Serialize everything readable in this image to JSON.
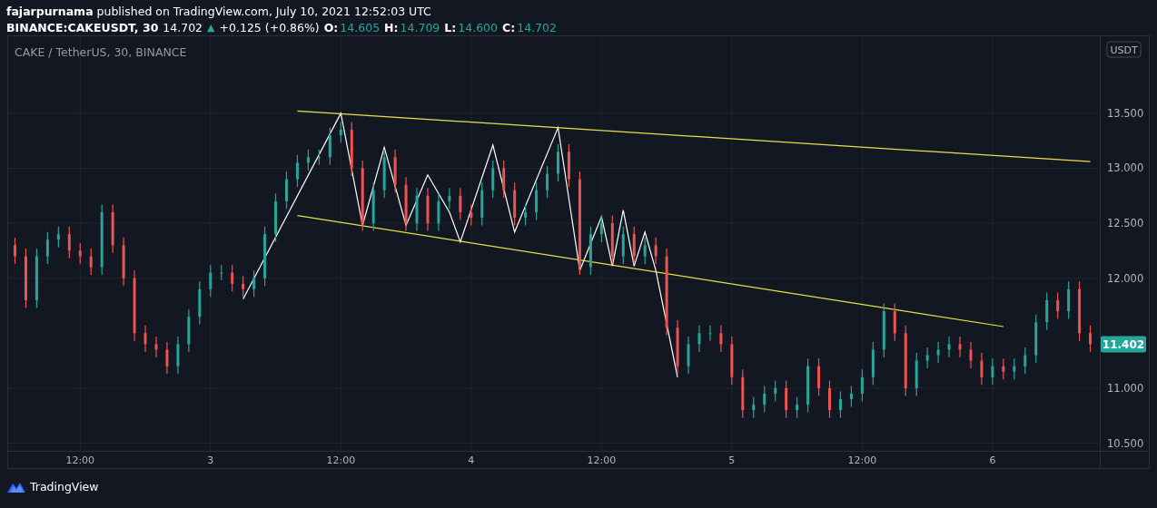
{
  "header": {
    "published": "**fajarpurnama** published on TradingView.com, July 10, 2021 12:52:03 UTC"
  },
  "symbol_line": {
    "symbol": "BINANCE:CAKEUSDT, 30",
    "last": "14.702",
    "arrow": "▲",
    "change": "+0.125 (+0.86%)",
    "ohlc": [
      {
        "label": "O:",
        "value": "14.605"
      },
      {
        "label": "H:",
        "value": "14.709"
      },
      {
        "label": "L:",
        "value": "14.600"
      },
      {
        "label": "C:",
        "value": "14.702"
      }
    ]
  },
  "chart": {
    "legend": "CAKE / TetherUS, 30, BINANCE",
    "currency": "USDT",
    "last_price": "11.402",
    "chart_data": {
      "type": "candlestick",
      "categories": [
        null,
        null,
        null,
        null,
        null,
        null,
        "12:00",
        null,
        null,
        null,
        null,
        null,
        null,
        null,
        null,
        null,
        null,
        null,
        "3",
        null,
        null,
        null,
        null,
        null,
        null,
        null,
        null,
        null,
        null,
        null,
        "12:00",
        null,
        null,
        null,
        null,
        null,
        null,
        null,
        null,
        null,
        null,
        null,
        "4",
        null,
        null,
        null,
        null,
        null,
        null,
        null,
        null,
        null,
        null,
        null,
        "12:00",
        null,
        null,
        null,
        null,
        null,
        null,
        null,
        null,
        null,
        null,
        null,
        "5",
        null,
        null,
        null,
        null,
        null,
        null,
        null,
        null,
        null,
        null,
        null,
        "12:00",
        null,
        null,
        null,
        null,
        null,
        null,
        null,
        null,
        null,
        null,
        null,
        "6",
        null,
        null,
        null,
        null,
        null,
        null,
        null,
        null,
        null
      ],
      "ohlc": [
        [
          12.3,
          12.37,
          12.13,
          12.2
        ],
        [
          12.2,
          12.27,
          11.73,
          11.8
        ],
        [
          11.8,
          12.27,
          11.73,
          12.2
        ],
        [
          12.2,
          12.42,
          12.13,
          12.35
        ],
        [
          12.35,
          12.47,
          12.28,
          12.4
        ],
        [
          12.4,
          12.47,
          12.18,
          12.25
        ],
        [
          12.25,
          12.32,
          12.13,
          12.2
        ],
        [
          12.2,
          12.27,
          12.03,
          12.1
        ],
        [
          12.1,
          12.67,
          12.03,
          12.6
        ],
        [
          12.6,
          12.67,
          12.23,
          12.3
        ],
        [
          12.3,
          12.37,
          11.93,
          12.0
        ],
        [
          12.0,
          12.07,
          11.43,
          11.5
        ],
        [
          11.5,
          11.57,
          11.33,
          11.4
        ],
        [
          11.4,
          11.47,
          11.28,
          11.35
        ],
        [
          11.35,
          11.42,
          11.13,
          11.2
        ],
        [
          11.2,
          11.47,
          11.13,
          11.4
        ],
        [
          11.4,
          11.72,
          11.33,
          11.65
        ],
        [
          11.65,
          11.97,
          11.58,
          11.9
        ],
        [
          11.9,
          12.12,
          11.83,
          12.05
        ],
        [
          12.05,
          12.12,
          11.98,
          12.05
        ],
        [
          12.05,
          12.12,
          11.88,
          11.95
        ],
        [
          11.95,
          12.02,
          11.83,
          11.9
        ],
        [
          11.9,
          12.07,
          11.83,
          12.0
        ],
        [
          12.0,
          12.47,
          11.93,
          12.4
        ],
        [
          12.4,
          12.77,
          12.33,
          12.7
        ],
        [
          12.7,
          12.97,
          12.63,
          12.9
        ],
        [
          12.9,
          13.12,
          12.83,
          13.05
        ],
        [
          13.05,
          13.17,
          12.98,
          13.1
        ],
        [
          13.1,
          13.17,
          13.03,
          13.1
        ],
        [
          13.1,
          13.37,
          13.03,
          13.3
        ],
        [
          13.3,
          13.42,
          13.23,
          13.35
        ],
        [
          13.35,
          13.42,
          12.93,
          13.0
        ],
        [
          13.0,
          13.07,
          12.43,
          12.5
        ],
        [
          12.5,
          12.87,
          12.43,
          12.8
        ],
        [
          12.8,
          13.17,
          12.73,
          13.1
        ],
        [
          13.1,
          13.17,
          12.78,
          12.85
        ],
        [
          12.85,
          12.92,
          12.43,
          12.5
        ],
        [
          12.5,
          12.82,
          12.43,
          12.75
        ],
        [
          12.75,
          12.82,
          12.43,
          12.5
        ],
        [
          12.5,
          12.77,
          12.43,
          12.7
        ],
        [
          12.7,
          12.82,
          12.63,
          12.75
        ],
        [
          12.75,
          12.82,
          12.53,
          12.6
        ],
        [
          12.6,
          12.67,
          12.48,
          12.55
        ],
        [
          12.55,
          12.87,
          12.48,
          12.8
        ],
        [
          12.8,
          13.07,
          12.73,
          13.0
        ],
        [
          13.0,
          13.07,
          12.73,
          12.8
        ],
        [
          12.8,
          12.87,
          12.48,
          12.55
        ],
        [
          12.55,
          12.67,
          12.48,
          12.6
        ],
        [
          12.6,
          12.87,
          12.53,
          12.8
        ],
        [
          12.8,
          13.02,
          12.73,
          12.95
        ],
        [
          12.95,
          13.22,
          12.88,
          13.15
        ],
        [
          13.15,
          13.22,
          12.83,
          12.9
        ],
        [
          12.9,
          12.97,
          12.03,
          12.1
        ],
        [
          12.1,
          12.47,
          12.03,
          12.4
        ],
        [
          12.4,
          12.57,
          12.33,
          12.5
        ],
        [
          12.5,
          12.57,
          12.13,
          12.2
        ],
        [
          12.2,
          12.47,
          12.13,
          12.4
        ],
        [
          12.4,
          12.47,
          12.13,
          12.2
        ],
        [
          12.2,
          12.37,
          12.13,
          12.3
        ],
        [
          12.3,
          12.37,
          12.13,
          12.2
        ],
        [
          12.2,
          12.27,
          11.48,
          11.55
        ],
        [
          11.55,
          11.62,
          11.13,
          11.2
        ],
        [
          11.2,
          11.47,
          11.13,
          11.4
        ],
        [
          11.4,
          11.57,
          11.33,
          11.5
        ],
        [
          11.5,
          11.57,
          11.43,
          11.5
        ],
        [
          11.5,
          11.57,
          11.33,
          11.4
        ],
        [
          11.4,
          11.47,
          11.03,
          11.1
        ],
        [
          11.1,
          11.17,
          10.73,
          10.8
        ],
        [
          10.8,
          10.92,
          10.73,
          10.85
        ],
        [
          10.85,
          11.02,
          10.78,
          10.95
        ],
        [
          10.95,
          11.07,
          10.88,
          11.0
        ],
        [
          11.0,
          11.07,
          10.73,
          10.8
        ],
        [
          10.8,
          10.92,
          10.73,
          10.85
        ],
        [
          10.85,
          11.27,
          10.78,
          11.2
        ],
        [
          11.2,
          11.27,
          10.93,
          11.0
        ],
        [
          11.0,
          11.07,
          10.73,
          10.8
        ],
        [
          10.8,
          10.97,
          10.73,
          10.9
        ],
        [
          10.9,
          11.02,
          10.83,
          10.95
        ],
        [
          10.95,
          11.17,
          10.88,
          11.1
        ],
        [
          11.1,
          11.42,
          11.03,
          11.35
        ],
        [
          11.35,
          11.77,
          11.28,
          11.7
        ],
        [
          11.7,
          11.77,
          11.43,
          11.5
        ],
        [
          11.5,
          11.57,
          10.93,
          11.0
        ],
        [
          11.0,
          11.32,
          10.93,
          11.25
        ],
        [
          11.25,
          11.37,
          11.18,
          11.3
        ],
        [
          11.3,
          11.42,
          11.23,
          11.35
        ],
        [
          11.35,
          11.47,
          11.28,
          11.4
        ],
        [
          11.4,
          11.47,
          11.28,
          11.35
        ],
        [
          11.35,
          11.42,
          11.18,
          11.25
        ],
        [
          11.25,
          11.32,
          11.03,
          11.1
        ],
        [
          11.1,
          11.27,
          11.03,
          11.2
        ],
        [
          11.2,
          11.27,
          11.08,
          11.15
        ],
        [
          11.15,
          11.27,
          11.08,
          11.2
        ],
        [
          11.2,
          11.37,
          11.13,
          11.3
        ],
        [
          11.3,
          11.67,
          11.23,
          11.6
        ],
        [
          11.6,
          11.87,
          11.53,
          11.8
        ],
        [
          11.8,
          11.87,
          11.63,
          11.7
        ],
        [
          11.7,
          11.97,
          11.63,
          11.9
        ],
        [
          11.9,
          11.97,
          11.43,
          11.5
        ],
        [
          11.5,
          11.57,
          11.33,
          11.4
        ]
      ],
      "series": [
        {
          "type": "line",
          "color": "#ffffff",
          "values": [
            null,
            null,
            null,
            null,
            null,
            null,
            null,
            null,
            null,
            null,
            null,
            null,
            null,
            null,
            null,
            null,
            null,
            null,
            null,
            null,
            null,
            11.81,
            null,
            null,
            null,
            null,
            null,
            null,
            null,
            null,
            13.5,
            null,
            12.48,
            null,
            13.19,
            null,
            12.48,
            null,
            12.94,
            null,
            12.6,
            12.33,
            null,
            null,
            13.21,
            null,
            12.42,
            null,
            null,
            null,
            13.37,
            null,
            12.07,
            null,
            12.56,
            12.11,
            12.62,
            12.11,
            12.42,
            12.07,
            null,
            11.1,
            null,
            null,
            null,
            null,
            null,
            null,
            null,
            null,
            null,
            null,
            null,
            null,
            null,
            null,
            null,
            null,
            null,
            null,
            null,
            null,
            null,
            null,
            null,
            null,
            null,
            null,
            null,
            null,
            null,
            null,
            null,
            null,
            null,
            null,
            null,
            null,
            null,
            null
          ]
        },
        {
          "type": "line",
          "color": "#e8e04a",
          "values": [
            null,
            null,
            null,
            null,
            null,
            null,
            null,
            null,
            null,
            null,
            null,
            null,
            null,
            null,
            null,
            null,
            null,
            null,
            null,
            null,
            null,
            null,
            null,
            null,
            null,
            null,
            13.52,
            null,
            null,
            null,
            null,
            null,
            null,
            null,
            null,
            null,
            null,
            null,
            null,
            null,
            null,
            null,
            null,
            null,
            null,
            null,
            null,
            null,
            null,
            null,
            null,
            null,
            null,
            null,
            null,
            null,
            null,
            null,
            null,
            null,
            null,
            null,
            null,
            null,
            null,
            null,
            null,
            null,
            null,
            null,
            null,
            null,
            null,
            null,
            null,
            null,
            null,
            null,
            null,
            null,
            null,
            null,
            null,
            null,
            null,
            null,
            null,
            null,
            null,
            null,
            null,
            null,
            null,
            null,
            null,
            null,
            null,
            null,
            null,
            13.06
          ]
        },
        {
          "type": "line",
          "color": "#e8e04a",
          "values": [
            null,
            null,
            null,
            null,
            null,
            null,
            null,
            null,
            null,
            null,
            null,
            null,
            null,
            null,
            null,
            null,
            null,
            null,
            null,
            null,
            null,
            null,
            null,
            null,
            null,
            null,
            12.57,
            null,
            null,
            null,
            null,
            null,
            null,
            null,
            null,
            null,
            null,
            null,
            null,
            null,
            null,
            null,
            null,
            null,
            null,
            null,
            null,
            null,
            null,
            null,
            null,
            null,
            null,
            null,
            null,
            null,
            null,
            null,
            null,
            null,
            null,
            null,
            null,
            null,
            null,
            null,
            null,
            null,
            null,
            null,
            null,
            null,
            null,
            null,
            null,
            null,
            null,
            null,
            null,
            null,
            null,
            null,
            null,
            null,
            null,
            null,
            null,
            null,
            null,
            null,
            null,
            11.56,
            null,
            null,
            null,
            null,
            null,
            null,
            null,
            null
          ]
        }
      ],
      "ylim": [
        10.43,
        14.2
      ],
      "grid": true,
      "yticks": [
        {
          "value": 10.5,
          "label": "10.500"
        },
        {
          "value": 11,
          "label": "11.000"
        },
        {
          "value": 12,
          "label": "12.000"
        },
        {
          "value": 12.5,
          "label": "12.500"
        },
        {
          "value": 13,
          "label": "13.000"
        },
        {
          "value": 13.5,
          "label": "13.500"
        }
      ]
    }
  },
  "footer": {
    "brand": "TradingView"
  }
}
